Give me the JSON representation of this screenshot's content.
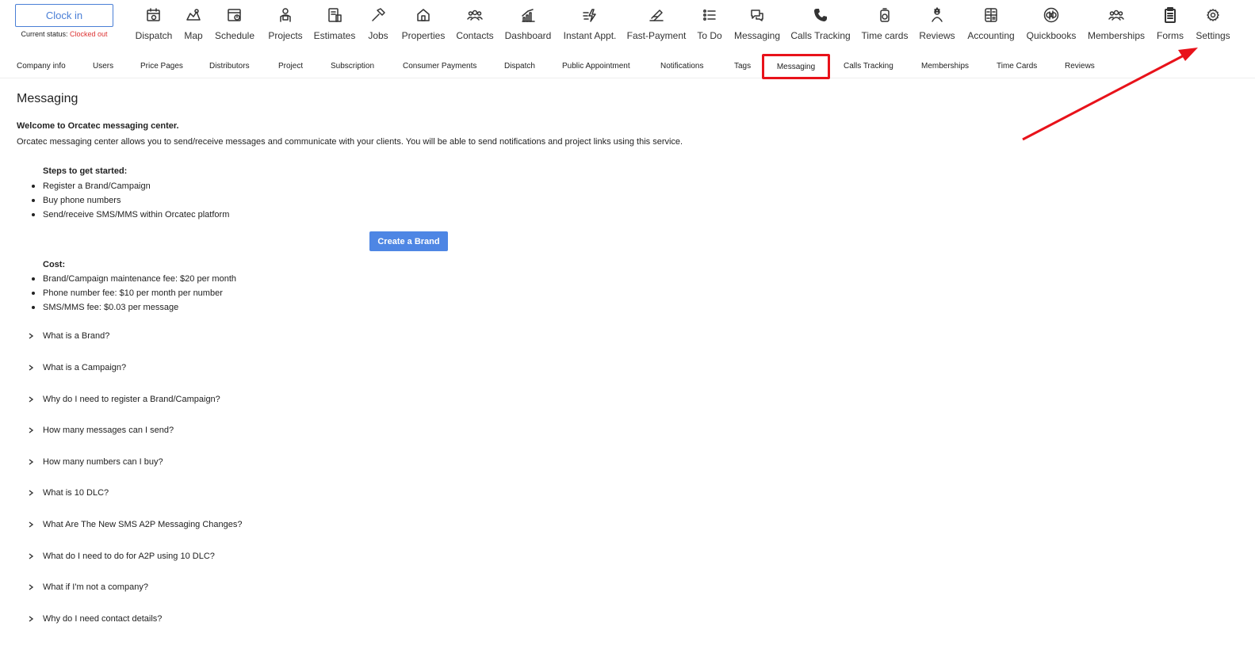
{
  "clock": {
    "button_label": "Clock in",
    "status_prefix": "Current status:",
    "status_value": "Clocked out"
  },
  "nav": [
    {
      "label": "Dispatch",
      "icon": "calendar-clock-icon"
    },
    {
      "label": "Map",
      "icon": "map-icon"
    },
    {
      "label": "Schedule",
      "icon": "schedule-icon"
    },
    {
      "label": "Projects",
      "icon": "projects-icon"
    },
    {
      "label": "Estimates",
      "icon": "estimates-icon"
    },
    {
      "label": "Jobs",
      "icon": "hammer-icon"
    },
    {
      "label": "Properties",
      "icon": "home-icon"
    },
    {
      "label": "Contacts",
      "icon": "contacts-icon"
    },
    {
      "label": "Dashboard",
      "icon": "chart-icon"
    },
    {
      "label": "Instant Appt.",
      "icon": "instant-icon"
    },
    {
      "label": "Fast-Payment",
      "icon": "payment-icon"
    },
    {
      "label": "To Do",
      "icon": "list-icon"
    },
    {
      "label": "Messaging",
      "icon": "chat-icon"
    },
    {
      "label": "Calls Tracking",
      "icon": "phone-icon"
    },
    {
      "label": "Time cards",
      "icon": "timecard-icon"
    },
    {
      "label": "Reviews",
      "icon": "reviews-icon"
    },
    {
      "label": "Accounting",
      "icon": "calculator-icon"
    },
    {
      "label": "Quickbooks",
      "icon": "quickbooks-icon"
    },
    {
      "label": "Memberships",
      "icon": "users-icon"
    },
    {
      "label": "Forms",
      "icon": "clipboard-icon"
    },
    {
      "label": "Settings",
      "icon": "gear-icon"
    }
  ],
  "subnav": [
    "Company info",
    "Users",
    "Price Pages",
    "Distributors",
    "Project",
    "Subscription",
    "Consumer Payments",
    "Dispatch",
    "Public Appointment",
    "Notifications",
    "Tags",
    "Messaging",
    "Calls Tracking",
    "Memberships",
    "Time Cards",
    "Reviews"
  ],
  "subnav_active": "Messaging",
  "main": {
    "title": "Messaging",
    "welcome": "Welcome to Orcatec messaging center.",
    "intro": "Orcatec messaging center allows you to send/receive messages and communicate with your clients. You will be able to send notifications and project links using this service.",
    "steps_title": "Steps to get started:",
    "steps": [
      "Register a Brand/Campaign",
      "Buy phone numbers",
      "Send/receive SMS/MMS within Orcatec platform"
    ],
    "create_button": "Create a Brand",
    "cost_title": "Cost:",
    "costs": [
      "Brand/Campaign maintenance fee: $20 per month",
      "Phone number fee: $10 per month per number",
      "SMS/MMS fee: $0.03 per message"
    ],
    "faqs": [
      "What is a Brand?",
      "What is a Campaign?",
      "Why do I need to register a Brand/Campaign?",
      "How many messages can I send?",
      "How many numbers can I buy?",
      "What is 10 DLC?",
      "What Are The New SMS A2P Messaging Changes?",
      "What do I need to do for A2P using 10 DLC?",
      "What if I'm not a company?",
      "Why do I need contact details?"
    ]
  },
  "colors": {
    "accent": "#4e86e4",
    "highlight": "#e8121a",
    "status_out": "#dd3333"
  }
}
